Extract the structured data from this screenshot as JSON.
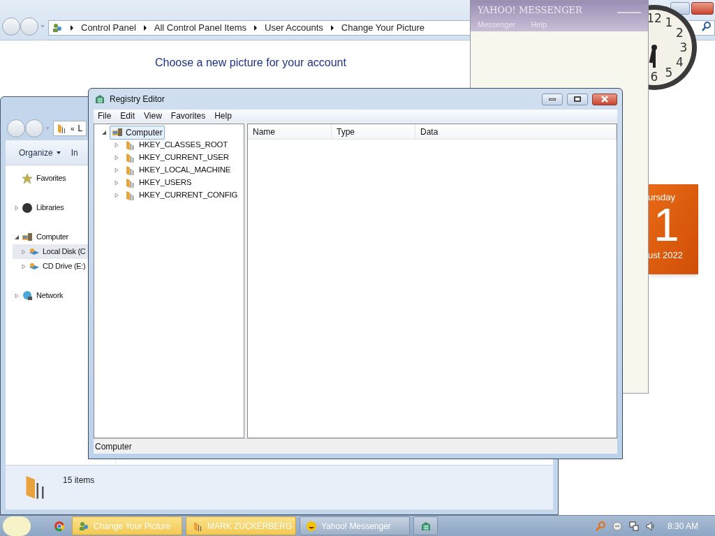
{
  "control_panel": {
    "breadcrumb": [
      "Control Panel",
      "All Control Panel Items",
      "User Accounts",
      "Change Your Picture"
    ],
    "heading": "Choose a new picture for your account"
  },
  "explorer": {
    "address": {
      "chevron": "«",
      "text": "L"
    },
    "toolbar": [
      "Organize",
      "In"
    ],
    "nav": [
      {
        "label": "Favorites",
        "kind": "favorites",
        "selected": false
      },
      {
        "label": "Libraries",
        "kind": "libraries",
        "expanded": false,
        "selected": false
      },
      {
        "label": "Computer",
        "kind": "computer",
        "expanded": true,
        "selected": false,
        "children": [
          {
            "label": "Local Disk (C",
            "kind": "drive",
            "expanded": false,
            "selected": true
          },
          {
            "label": "CD Drive (E:)",
            "kind": "drive",
            "expanded": false,
            "selected": false
          }
        ]
      },
      {
        "label": "Network",
        "kind": "network",
        "expanded": false,
        "selected": false
      }
    ],
    "status": "15 items"
  },
  "registry_editor": {
    "title": "Registry Editor",
    "menu": [
      "File",
      "Edit",
      "View",
      "Favorites",
      "Help"
    ],
    "tree": {
      "label": "Computer",
      "selected": true,
      "expanded": true,
      "children": [
        {
          "label": "HKEY_CLASSES_ROOT",
          "selected": false,
          "expanded": false
        },
        {
          "label": "HKEY_CURRENT_USER",
          "selected": false,
          "expanded": false
        },
        {
          "label": "HKEY_LOCAL_MACHINE",
          "selected": false,
          "expanded": false
        },
        {
          "label": "HKEY_USERS",
          "selected": false,
          "expanded": false
        },
        {
          "label": "HKEY_CURRENT_CONFIG",
          "selected": false,
          "expanded": false
        }
      ]
    },
    "columns": [
      "Name",
      "Type",
      "Data"
    ],
    "status": "Computer"
  },
  "messenger": {
    "title": "YAHOO! MESSENGER",
    "menu": [
      "Messenger",
      "Help"
    ]
  },
  "clock": {
    "numerals": [
      "12",
      "1",
      "2",
      "3",
      "4",
      "5",
      "6"
    ]
  },
  "calendar": {
    "weekday": "ursday",
    "day": "1",
    "month_year": "ust 2022"
  },
  "taskbar": {
    "buttons": [
      {
        "label": "Change Your Picture",
        "kind": "users",
        "highlighted": true
      },
      {
        "label": "MARK ZUCKERBERG",
        "kind": "folder",
        "highlighted": true
      },
      {
        "label": "Yahoo! Messenger",
        "kind": "smiley",
        "highlighted": false
      },
      {
        "kind": "registry",
        "highlighted": false
      }
    ],
    "time": "8:30 AM"
  }
}
